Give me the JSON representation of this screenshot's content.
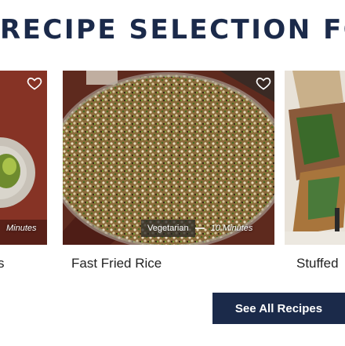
{
  "heading": "RECIPE SELECTION FOR",
  "cards": [
    {
      "title": "s",
      "tag": "",
      "time": "Minutes",
      "favorite_icon": "heart-outline-icon"
    },
    {
      "title": "Fast Fried Rice",
      "tag": "Vegetarian",
      "time": "10 Minutes",
      "favorite_icon": "heart-outline-icon"
    },
    {
      "title": "Stuffed",
      "tag": "",
      "time": ""
    }
  ],
  "see_all_label": "See All Recipes",
  "colors": {
    "heading": "#1b2a4a",
    "button": "#1b2a4a",
    "text": "#222222"
  }
}
